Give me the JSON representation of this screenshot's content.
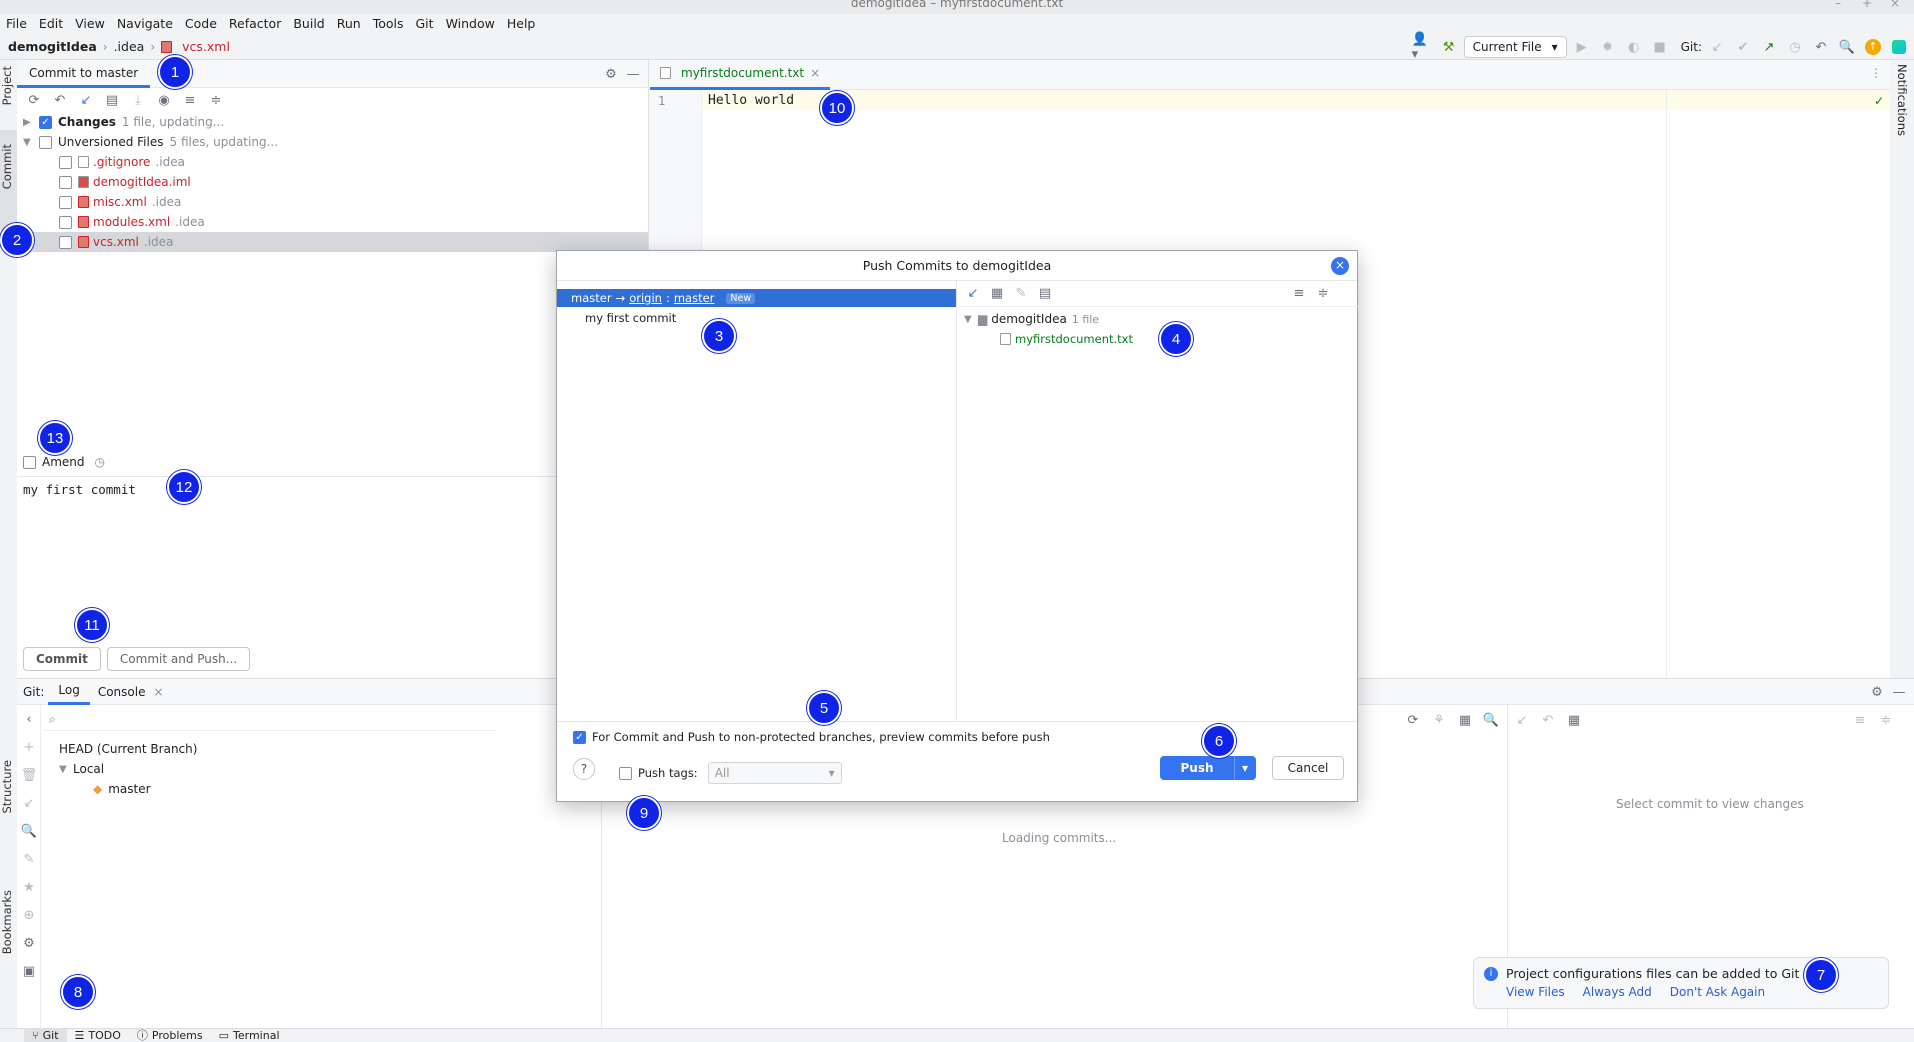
{
  "window": {
    "title": "demogitIdea – myfirstdocument.txt"
  },
  "menu": [
    "File",
    "Edit",
    "View",
    "Navigate",
    "Code",
    "Refactor",
    "Build",
    "Run",
    "Tools",
    "Git",
    "Window",
    "Help"
  ],
  "breadcrumb": {
    "project": "demogitIdea",
    "folder": ".idea",
    "file": "vcs.xml"
  },
  "toolbar": {
    "run_config": "Current File",
    "git_label": "Git:"
  },
  "stripes": {
    "project": "Project",
    "commit": "Commit",
    "structure": "Structure",
    "bookmarks": "Bookmarks",
    "notifications": "Notifications"
  },
  "commit_panel": {
    "tab": "Commit to master",
    "changes_label": "Changes",
    "changes_status": "1 file, updating...",
    "unversioned_label": "Unversioned Files",
    "unversioned_status": "5 files, updating...",
    "files": [
      {
        "name": ".gitignore",
        "dir": ".idea"
      },
      {
        "name": "demogitIdea.iml",
        "dir": ""
      },
      {
        "name": "misc.xml",
        "dir": ".idea"
      },
      {
        "name": "modules.xml",
        "dir": ".idea"
      },
      {
        "name": "vcs.xml",
        "dir": ".idea"
      }
    ],
    "amend_label": "Amend",
    "message": "my first commit",
    "commit_button": "Commit",
    "commit_push_button": "Commit and Push..."
  },
  "editor": {
    "tab": "myfirstdocument.txt",
    "line_number": "1",
    "content": "Hello world"
  },
  "git_tool": {
    "title": "Git:",
    "tabs": [
      "Log",
      "Console"
    ],
    "branches_head": "HEAD (Current Branch)",
    "branches_local": "Local",
    "branch_master": "master",
    "loading": "Loading commits...",
    "select_commit": "Select commit to view changes"
  },
  "notification": {
    "text": "Project configurations files can be added to Git",
    "actions": [
      "View Files",
      "Always Add",
      "Don't Ask Again"
    ]
  },
  "dialog": {
    "title": "Push Commits to demogitIdea",
    "branch_local": "master",
    "arrow": "→",
    "remote": "origin",
    "colon": ":",
    "branch_remote": "master",
    "new_badge": "New",
    "commit": "my first commit",
    "repo": "demogitIdea",
    "repo_count": "1 file",
    "file": "myfirstdocument.txt",
    "preview_option": "For Commit and Push to non-protected branches, preview commits before push",
    "push_tags_label": "Push tags:",
    "tags_value": "All",
    "push_button": "Push",
    "cancel_button": "Cancel",
    "help": "?"
  },
  "statusbar": [
    "Git",
    "TODO",
    "Problems",
    "Terminal"
  ],
  "markers": [
    "1",
    "2",
    "3",
    "4",
    "5",
    "6",
    "7",
    "8",
    "9",
    "10",
    "11",
    "12",
    "13"
  ],
  "colors": {
    "accent": "#3574f0",
    "marker": "#1024e8",
    "unversioned": "#c7222d",
    "added": "#067d17"
  }
}
